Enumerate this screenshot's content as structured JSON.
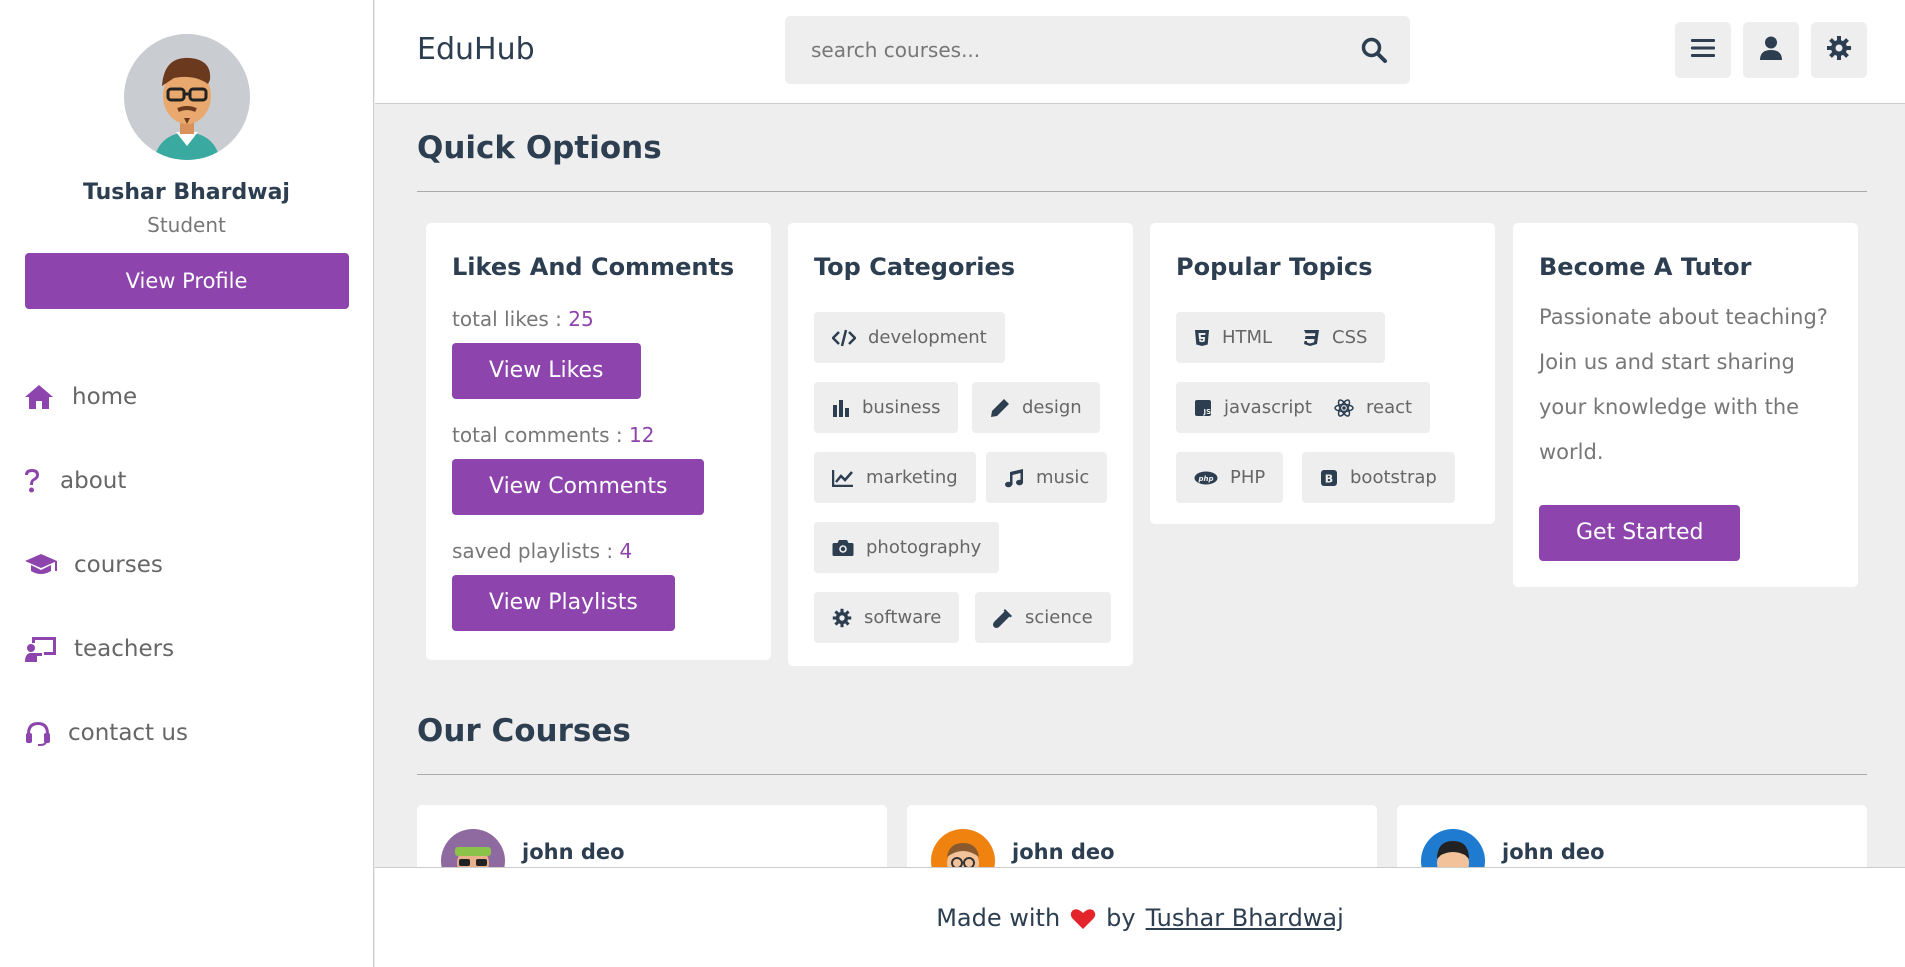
{
  "app": {
    "logo": "EduHub"
  },
  "search": {
    "placeholder": "search courses..."
  },
  "profile": {
    "name": "Tushar Bhardwaj",
    "role": "Student",
    "button": "View Profile"
  },
  "nav": [
    {
      "label": "home",
      "icon": "home-icon"
    },
    {
      "label": "about",
      "icon": "question-icon"
    },
    {
      "label": "courses",
      "icon": "graduation-cap-icon"
    },
    {
      "label": "teachers",
      "icon": "chalkboard-teacher-icon"
    },
    {
      "label": "contact us",
      "icon": "headset-icon"
    }
  ],
  "quick": {
    "title": "Quick Options",
    "likes": {
      "title": "Likes And Comments",
      "likes_label": "total likes : ",
      "likes_value": "25",
      "likes_button": "View Likes",
      "comments_label": "total comments : ",
      "comments_value": "12",
      "comments_button": "View Comments",
      "playlists_label": "saved playlists : ",
      "playlists_value": "4",
      "playlists_button": "View Playlists"
    },
    "categories": {
      "title": "Top Categories",
      "items": [
        {
          "label": "development",
          "icon": "code-icon"
        },
        {
          "label": "business",
          "icon": "chart-bar-icon"
        },
        {
          "label": "design",
          "icon": "pen-icon"
        },
        {
          "label": "marketing",
          "icon": "chart-line-icon"
        },
        {
          "label": "music",
          "icon": "music-icon"
        },
        {
          "label": "photography",
          "icon": "camera-icon"
        },
        {
          "label": "software",
          "icon": "cog-icon"
        },
        {
          "label": "science",
          "icon": "vial-icon"
        }
      ]
    },
    "topics": {
      "title": "Popular Topics",
      "items": [
        {
          "label": "HTML",
          "icon": "html5-icon"
        },
        {
          "label": "CSS",
          "icon": "css3-icon"
        },
        {
          "label": "javascript",
          "icon": "js-icon"
        },
        {
          "label": "react",
          "icon": "react-icon"
        },
        {
          "label": "PHP",
          "icon": "php-icon"
        },
        {
          "label": "bootstrap",
          "icon": "bootstrap-icon"
        }
      ]
    },
    "tutor": {
      "title": "Become A Tutor",
      "line1": "Passionate about teaching?",
      "line2": "Join us and start sharing",
      "line3": "your knowledge with the",
      "line4": "world.",
      "button": "Get Started"
    }
  },
  "courses": {
    "title": "Our Courses",
    "items": [
      {
        "author": "john deo",
        "avatar_color": "#8e6aa0"
      },
      {
        "author": "john deo",
        "avatar_color": "#f0830f"
      },
      {
        "author": "john deo",
        "avatar_color": "#1f7bd0"
      }
    ]
  },
  "footer": {
    "prefix": "Made with",
    "by": "by",
    "author": "Tushar Bhardwaj"
  },
  "colors": {
    "accent": "#8e44ad",
    "text": "#2c3e50",
    "background": "#eeeeee"
  }
}
